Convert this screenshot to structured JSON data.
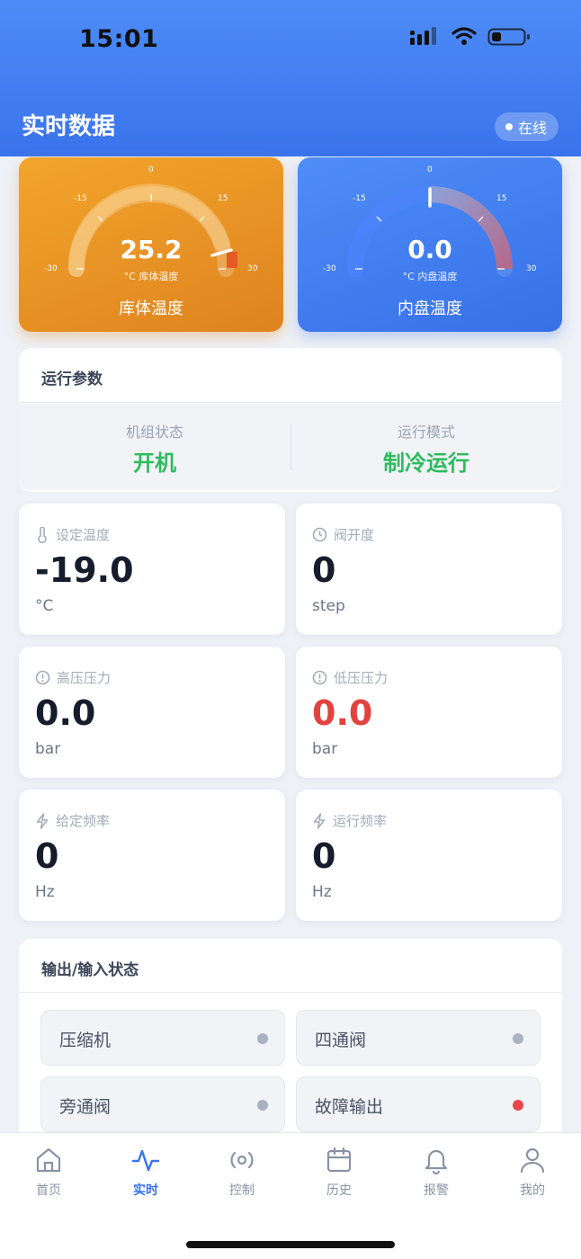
{
  "status_bar": {
    "time": "15:01"
  },
  "header": {
    "title": "实时数据",
    "online_label": "在线"
  },
  "gauges": [
    {
      "value": "25.2",
      "unit_label": "°C 库体温度",
      "label": "库体温度",
      "ticks": {
        "left": "-30",
        "left_mid": "-15",
        "top": "0",
        "right_mid": "15",
        "right": "30"
      },
      "color": "#f3a52b"
    },
    {
      "value": "0.0",
      "unit_label": "°C 内盘温度",
      "label": "内盘温度",
      "ticks": {
        "left": "-30",
        "left_mid": "-15",
        "top": "0",
        "right_mid": "15",
        "right": "30"
      },
      "color": "#4f8df7"
    }
  ],
  "params": {
    "title": "运行参数",
    "unit_status_label": "机组状态",
    "unit_status_value": "开机",
    "mode_label": "运行模式",
    "mode_value": "制冷运行",
    "metrics": [
      {
        "label": "设定温度",
        "value": "-19.0",
        "unit": "°C",
        "icon": "thermometer-icon"
      },
      {
        "label": "阀开度",
        "value": "0",
        "unit": "step",
        "icon": "clock-icon"
      },
      {
        "label": "高压压力",
        "value": "0.0",
        "unit": "bar",
        "icon": "alert-circle-icon"
      },
      {
        "label": "低压压力",
        "value": "0.0",
        "unit": "bar",
        "icon": "alert-circle-icon",
        "value_color": "#e2433f"
      },
      {
        "label": "给定频率",
        "value": "0",
        "unit": "Hz",
        "icon": "lightning-icon"
      },
      {
        "label": "运行频率",
        "value": "0",
        "unit": "Hz",
        "icon": "lightning-icon"
      }
    ]
  },
  "io": {
    "title": "输出/输入状态",
    "items": [
      {
        "label": "压缩机",
        "state": "off"
      },
      {
        "label": "四通阀",
        "state": "off"
      },
      {
        "label": "旁通阀",
        "state": "off"
      },
      {
        "label": "故障输出",
        "state": "alarm"
      }
    ]
  },
  "tabs": [
    {
      "label": "首页",
      "icon": "home-icon"
    },
    {
      "label": "实时",
      "icon": "activity-icon",
      "active": true
    },
    {
      "label": "控制",
      "icon": "radio-icon"
    },
    {
      "label": "历史",
      "icon": "calendar-icon"
    },
    {
      "label": "报警",
      "icon": "bell-icon"
    },
    {
      "label": "我的",
      "icon": "user-icon"
    }
  ],
  "colors": {
    "accent": "#3a73ec",
    "success": "#2dbb5d",
    "danger": "#e2433f",
    "orange": "#f3a52b"
  }
}
